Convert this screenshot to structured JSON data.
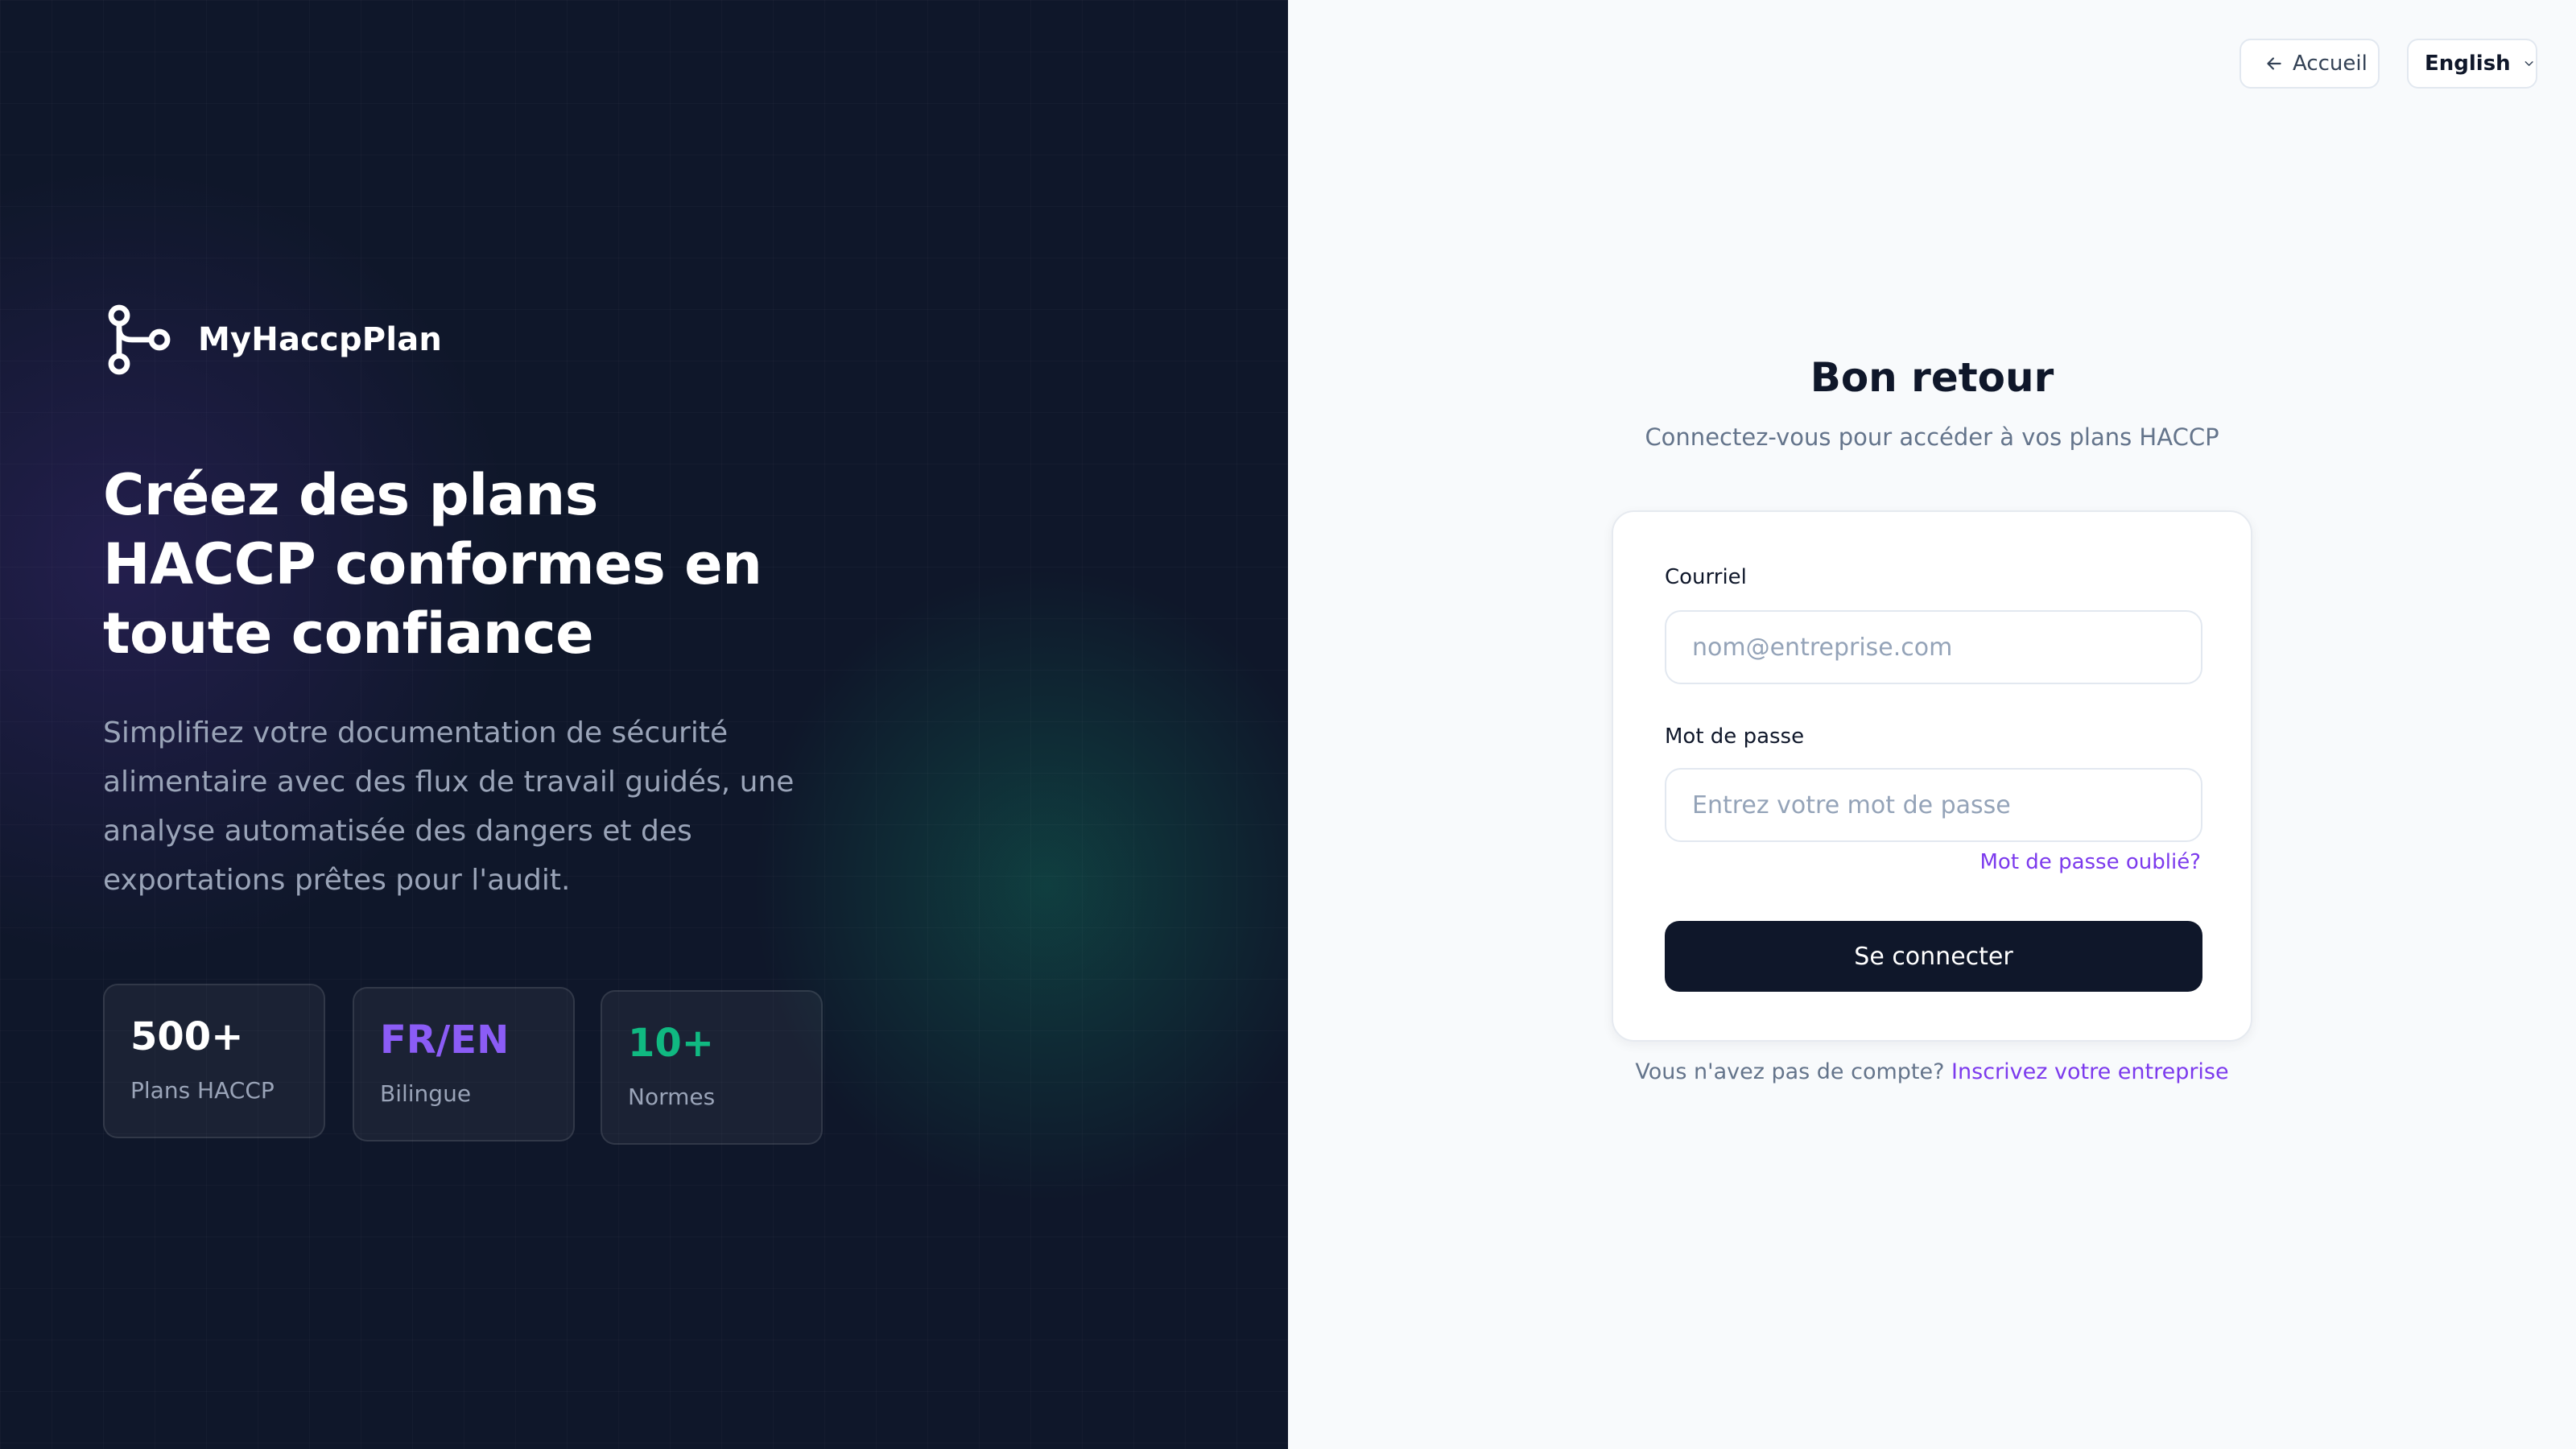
{
  "brand": {
    "name": "MyHaccpPlan",
    "logo_icon": "workflow-nodes-icon"
  },
  "hero": {
    "headline": "Créez des plans HACCP conformes en toute confiance",
    "description": "Simplifiez votre documentation de sécurité alimentaire avec des flux de travail guidés, une analyse automatisée des dangers et des exportations prêtes pour l'audit.",
    "stats": [
      {
        "value": "500+",
        "label": "Plans HACCP",
        "color": "#ffffff"
      },
      {
        "value": "FR/EN",
        "label": "Bilingue",
        "color": "#8b5cf6"
      },
      {
        "value": "10+",
        "label": "Normes",
        "color": "#10b981"
      }
    ]
  },
  "topbar": {
    "back_label": "Accueil",
    "back_icon": "arrow-left-icon",
    "language_label": "English",
    "language_icon": "chevron-down-icon"
  },
  "login": {
    "title": "Bon retour",
    "subtitle": "Connectez-vous pour accéder à vos plans HACCP",
    "email_label": "Courriel",
    "email_placeholder": "nom@entreprise.com",
    "email_value": "",
    "password_label": "Mot de passe",
    "password_placeholder": "Entrez votre mot de passe",
    "password_value": "",
    "forgot_label": "Mot de passe oublié?",
    "submit_label": "Se connecter",
    "no_account_text": "Vous n'avez pas de compte?",
    "signup_link": "Inscrivez votre entreprise"
  },
  "colors": {
    "accent": "#7c3aed",
    "dark": "#0f172a",
    "green": "#10b981",
    "purple": "#8b5cf6"
  }
}
